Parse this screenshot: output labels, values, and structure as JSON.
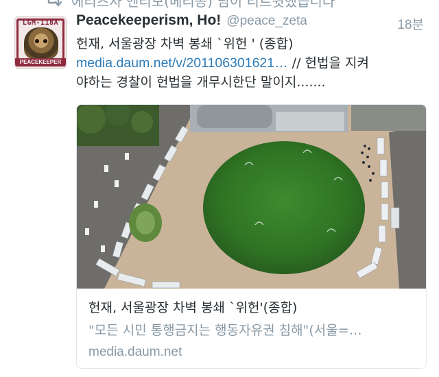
{
  "retweet_context": {
    "text": "에리츠자 엔리보(베리공) 님이 리트윗했습니다"
  },
  "tweet": {
    "author_name": "Peacekeeperism, Ho!",
    "author_handle": "@peace_zeta",
    "timestamp": "18분",
    "avatar": {
      "top_text": "LGM-118A",
      "bottom_text": "PEACEKEEPER"
    },
    "text_line1": "헌재, 서울광장 차벽 봉쇄 `위헌 ' (종합)",
    "link_text": "media.daum.net/v/201106301621…",
    "text_line2_rest": " // 헌법을 지켜",
    "text_line3": "야하는 경찰이 헌법을 개무시한단 말이지......."
  },
  "card": {
    "title": "헌재, 서울광장 차벽 봉쇄 `위헌'(종합)",
    "description": "\"모든 시민 통행금지는 행동자유권 침해\"(서울=…",
    "domain": "media.daum.net"
  },
  "colors": {
    "text": "#292f33",
    "secondary": "#8899a6",
    "link": "#2b7bb9",
    "border": "#e1e8ed"
  },
  "icons": {
    "retweet": "retweet-icon"
  }
}
